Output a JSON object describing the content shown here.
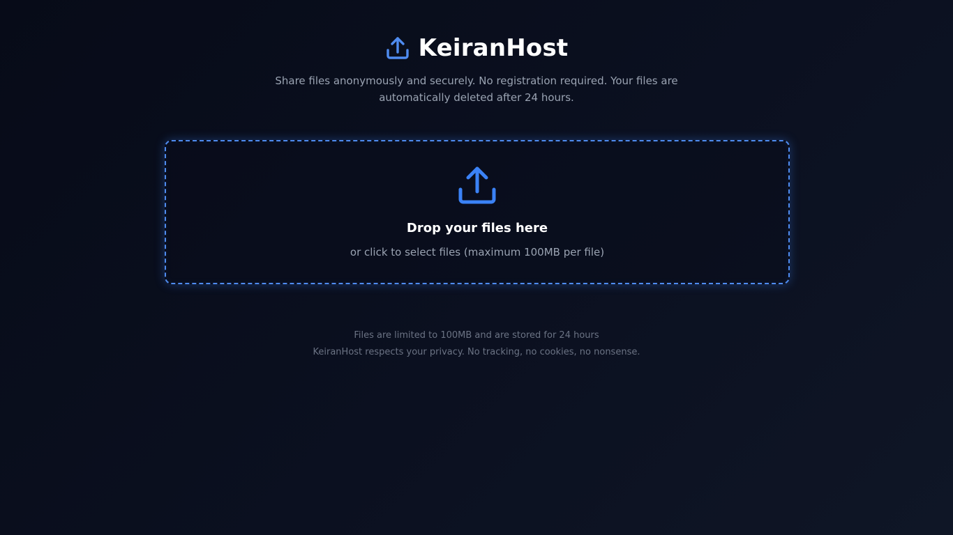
{
  "header": {
    "title": "KeiranHost",
    "logo_icon": "upload-icon",
    "subtitle": "Share files anonymously and securely. No registration required. Your files are automatically deleted after 24 hours."
  },
  "dropzone": {
    "icon": "upload-icon",
    "title": "Drop your files here",
    "hint": "or click to select files (maximum 100MB per file)"
  },
  "footer": {
    "line1": "Files are limited to 100MB and are stored for 24 hours",
    "line2": "KeiranHost respects your privacy. No tracking, no cookies, no nonsense."
  },
  "colors": {
    "accent": "#3b82f6",
    "background": "#0b1020",
    "muted_text": "#9aa3b2"
  }
}
